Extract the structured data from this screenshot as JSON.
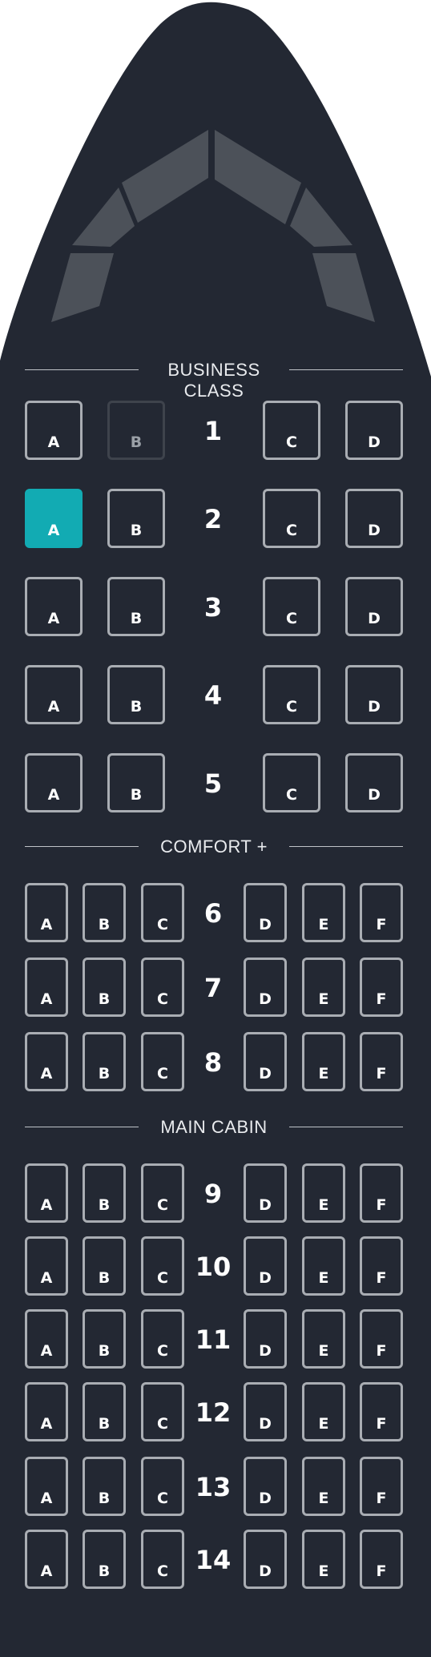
{
  "colors": {
    "fuselage": "#232833",
    "window_panels": "#4c5159",
    "seat_border": "#a9adb3",
    "seat_selected": "#12abb3",
    "seat_unavailable_border": "#3e434c",
    "divider_line": "#bfc3c8"
  },
  "sections": [
    {
      "title": "BUSINESS CLASS",
      "layout": [
        "A",
        "B",
        "|",
        "C",
        "D"
      ],
      "rows": [
        {
          "number": "1",
          "seats": [
            {
              "label": "A",
              "status": "available"
            },
            {
              "label": "B",
              "status": "unavailable"
            },
            {
              "label": "C",
              "status": "available"
            },
            {
              "label": "D",
              "status": "available"
            }
          ]
        },
        {
          "number": "2",
          "seats": [
            {
              "label": "A",
              "status": "selected"
            },
            {
              "label": "B",
              "status": "available"
            },
            {
              "label": "C",
              "status": "available"
            },
            {
              "label": "D",
              "status": "available"
            }
          ]
        },
        {
          "number": "3",
          "seats": [
            {
              "label": "A",
              "status": "available"
            },
            {
              "label": "B",
              "status": "available"
            },
            {
              "label": "C",
              "status": "available"
            },
            {
              "label": "D",
              "status": "available"
            }
          ]
        },
        {
          "number": "4",
          "seats": [
            {
              "label": "A",
              "status": "available"
            },
            {
              "label": "B",
              "status": "available"
            },
            {
              "label": "C",
              "status": "available"
            },
            {
              "label": "D",
              "status": "available"
            }
          ]
        },
        {
          "number": "5",
          "seats": [
            {
              "label": "A",
              "status": "available"
            },
            {
              "label": "B",
              "status": "available"
            },
            {
              "label": "C",
              "status": "available"
            },
            {
              "label": "D",
              "status": "available"
            }
          ]
        }
      ]
    },
    {
      "title": "COMFORT +",
      "layout": [
        "A",
        "B",
        "C",
        "|",
        "D",
        "E",
        "F"
      ],
      "rows": [
        {
          "number": "6",
          "seats": [
            {
              "label": "A",
              "status": "available"
            },
            {
              "label": "B",
              "status": "available"
            },
            {
              "label": "C",
              "status": "available"
            },
            {
              "label": "D",
              "status": "available"
            },
            {
              "label": "E",
              "status": "available"
            },
            {
              "label": "F",
              "status": "available"
            }
          ]
        },
        {
          "number": "7",
          "seats": [
            {
              "label": "A",
              "status": "available"
            },
            {
              "label": "B",
              "status": "available"
            },
            {
              "label": "C",
              "status": "available"
            },
            {
              "label": "D",
              "status": "available"
            },
            {
              "label": "E",
              "status": "available"
            },
            {
              "label": "F",
              "status": "available"
            }
          ]
        },
        {
          "number": "8",
          "seats": [
            {
              "label": "A",
              "status": "available"
            },
            {
              "label": "B",
              "status": "available"
            },
            {
              "label": "C",
              "status": "available"
            },
            {
              "label": "D",
              "status": "available"
            },
            {
              "label": "E",
              "status": "available"
            },
            {
              "label": "F",
              "status": "available"
            }
          ]
        }
      ]
    },
    {
      "title": "MAIN CABIN",
      "layout": [
        "A",
        "B",
        "C",
        "|",
        "D",
        "E",
        "F"
      ],
      "rows": [
        {
          "number": "9",
          "seats": [
            {
              "label": "A",
              "status": "available"
            },
            {
              "label": "B",
              "status": "available"
            },
            {
              "label": "C",
              "status": "available"
            },
            {
              "label": "D",
              "status": "available"
            },
            {
              "label": "E",
              "status": "available"
            },
            {
              "label": "F",
              "status": "available"
            }
          ]
        },
        {
          "number": "10",
          "seats": [
            {
              "label": "A",
              "status": "available"
            },
            {
              "label": "B",
              "status": "available"
            },
            {
              "label": "C",
              "status": "available"
            },
            {
              "label": "D",
              "status": "available"
            },
            {
              "label": "E",
              "status": "available"
            },
            {
              "label": "F",
              "status": "available"
            }
          ]
        },
        {
          "number": "11",
          "seats": [
            {
              "label": "A",
              "status": "available"
            },
            {
              "label": "B",
              "status": "available"
            },
            {
              "label": "C",
              "status": "available"
            },
            {
              "label": "D",
              "status": "available"
            },
            {
              "label": "E",
              "status": "available"
            },
            {
              "label": "F",
              "status": "available"
            }
          ]
        },
        {
          "number": "12",
          "seats": [
            {
              "label": "A",
              "status": "available"
            },
            {
              "label": "B",
              "status": "available"
            },
            {
              "label": "C",
              "status": "available"
            },
            {
              "label": "D",
              "status": "available"
            },
            {
              "label": "E",
              "status": "available"
            },
            {
              "label": "F",
              "status": "available"
            }
          ]
        },
        {
          "number": "13",
          "seats": [
            {
              "label": "A",
              "status": "available"
            },
            {
              "label": "B",
              "status": "available"
            },
            {
              "label": "C",
              "status": "available"
            },
            {
              "label": "D",
              "status": "available"
            },
            {
              "label": "E",
              "status": "available"
            },
            {
              "label": "F",
              "status": "available"
            }
          ]
        },
        {
          "number": "14",
          "seats": [
            {
              "label": "A",
              "status": "available"
            },
            {
              "label": "B",
              "status": "available"
            },
            {
              "label": "C",
              "status": "available"
            },
            {
              "label": "D",
              "status": "available"
            },
            {
              "label": "E",
              "status": "available"
            },
            {
              "label": "F",
              "status": "available"
            }
          ]
        }
      ]
    }
  ]
}
